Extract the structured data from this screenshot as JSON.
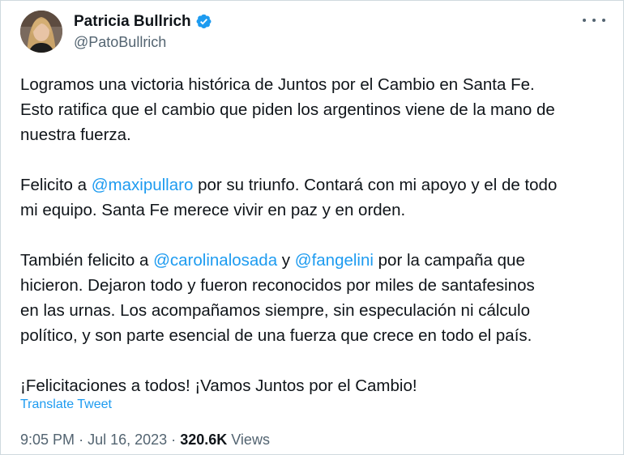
{
  "author": {
    "display_name": "Patricia Bullrich",
    "handle": "@PatoBullrich",
    "verified": true
  },
  "tweet": {
    "paragraphs": [
      [
        {
          "text": "Logramos una victoria histórica de Juntos por el Cambio en Santa Fe.",
          "br": true
        },
        {
          "text": "Esto ratifica que el cambio que piden los argentinos viene de la mano de",
          "br": true
        },
        {
          "text": "nuestra fuerza."
        }
      ],
      [
        {
          "text": "Felicito a "
        },
        {
          "text": "@maxipullaro",
          "mention": true
        },
        {
          "text": " por su triunfo. Contará con mi apoyo y el de todo",
          "br": true
        },
        {
          "text": "mi equipo. Santa Fe merece vivir en paz y en orden."
        }
      ],
      [
        {
          "text": "También felicito a "
        },
        {
          "text": "@carolinalosada",
          "mention": true
        },
        {
          "text": " y "
        },
        {
          "text": "@fangelini",
          "mention": true
        },
        {
          "text": " por la campaña que",
          "br": true
        },
        {
          "text": "hicieron. Dejaron todo y fueron reconocidos por miles de santafesinos",
          "br": true
        },
        {
          "text": "en las urnas. Los acompañamos siempre, sin especulación ni cálculo",
          "br": true
        },
        {
          "text": "político, y son parte esencial de una fuerza que crece en todo el país."
        }
      ],
      [
        {
          "text": "¡Felicitaciones a todos! ¡Vamos Juntos por el Cambio!"
        }
      ]
    ],
    "translate_label": "Translate Tweet",
    "time": "9:05 PM",
    "date": "Jul 16, 2023",
    "separator": "·",
    "views_count": "320.6K",
    "views_label": "Views"
  },
  "colors": {
    "link": "#1d9bf0",
    "text": "#0f1419",
    "secondary": "#536471",
    "verified_badge": "#1d9bf0"
  },
  "icons": {
    "verified": "verified-badge-icon",
    "more": "more-options-icon"
  }
}
